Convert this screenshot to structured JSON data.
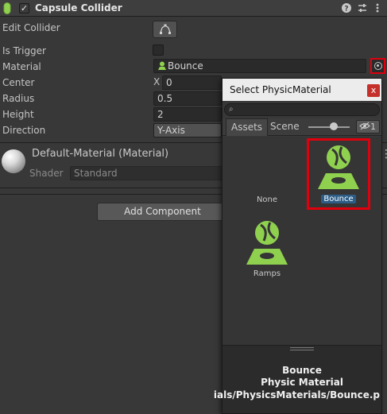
{
  "component": {
    "title": "Capsule Collider",
    "enabled": "✓",
    "help_icon": "help-icon",
    "presets_icon": "presets-icon",
    "more_icon": "more-icon"
  },
  "fields": {
    "edit_collider_label": "Edit Collider",
    "is_trigger_label": "Is Trigger",
    "material_label": "Material",
    "material_value": "Bounce",
    "center_label": "Center",
    "center_x_label": "X",
    "center_x_value": "0",
    "radius_label": "Radius",
    "radius_value": "0.5",
    "height_label": "Height",
    "height_value": "2",
    "direction_label": "Direction",
    "direction_value": "Y-Axis"
  },
  "material_section": {
    "title": "Default-Material (Material)",
    "shader_label": "Shader",
    "shader_value": "Standard",
    "more": "⋮"
  },
  "add_component_label": "Add Component",
  "picker": {
    "title": "Select PhysicMaterial",
    "close": "x",
    "tabs": [
      "Assets",
      "Scene"
    ],
    "hidden_count": "1",
    "items": [
      {
        "label": "None",
        "selected": false
      },
      {
        "label": "Bounce",
        "selected": true
      },
      {
        "label": "Ramps",
        "selected": false
      }
    ],
    "preview": {
      "name": "Bounce",
      "type": "Physic Material",
      "path": "ials/PhysicsMaterials/Bounce.p"
    }
  },
  "colors": {
    "accent_green": "#8fd14f",
    "highlight_red": "#e0000d",
    "selection_blue": "#2c5d87"
  }
}
